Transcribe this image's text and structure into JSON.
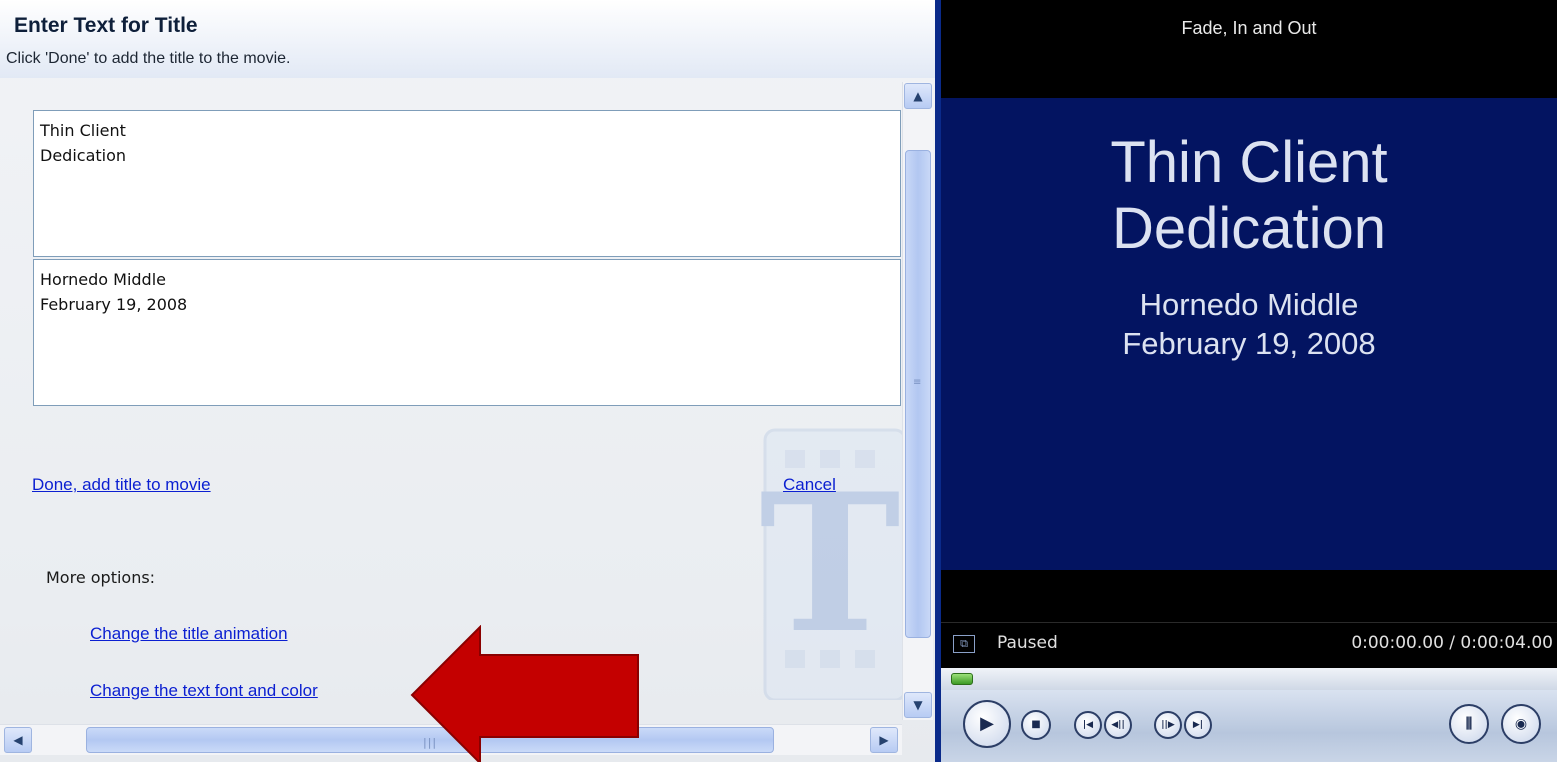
{
  "pane": {
    "title": "Enter Text for Title",
    "subtitle": "Click 'Done' to add the title to the movie.",
    "title_text": "Thin Client\nDedication",
    "subtitle_text": "Hornedo Middle\nFebruary 19, 2008",
    "done_link": "Done, add title to movie",
    "cancel_link": "Cancel",
    "more_options_label": "More options:",
    "animation_link": "Change the title animation",
    "font_color_link": "Change the text font and color"
  },
  "monitor": {
    "title": "Fade, In and Out",
    "video_title": "Thin Client\nDedication",
    "video_subtitle": "Hornedo Middle\nFebruary 19, 2008",
    "status": "Paused",
    "time": "0:00:00.00 / 0:00:04.00",
    "seek_progress": 0
  },
  "icons": [
    "scroll-up-icon",
    "scroll-down-icon",
    "scroll-left-icon",
    "scroll-right-icon",
    "play-icon",
    "stop-icon",
    "previous-frame-icon",
    "rewind-icon",
    "forward-icon",
    "next-frame-icon",
    "split-icon",
    "snapshot-icon",
    "full-screen-icon",
    "arrow-pointer-icon"
  ],
  "colors": {
    "accent_link": "#0b1fd1",
    "video_background": "#031461",
    "arrow": "#c40000",
    "divider": "#0a2a8a"
  }
}
